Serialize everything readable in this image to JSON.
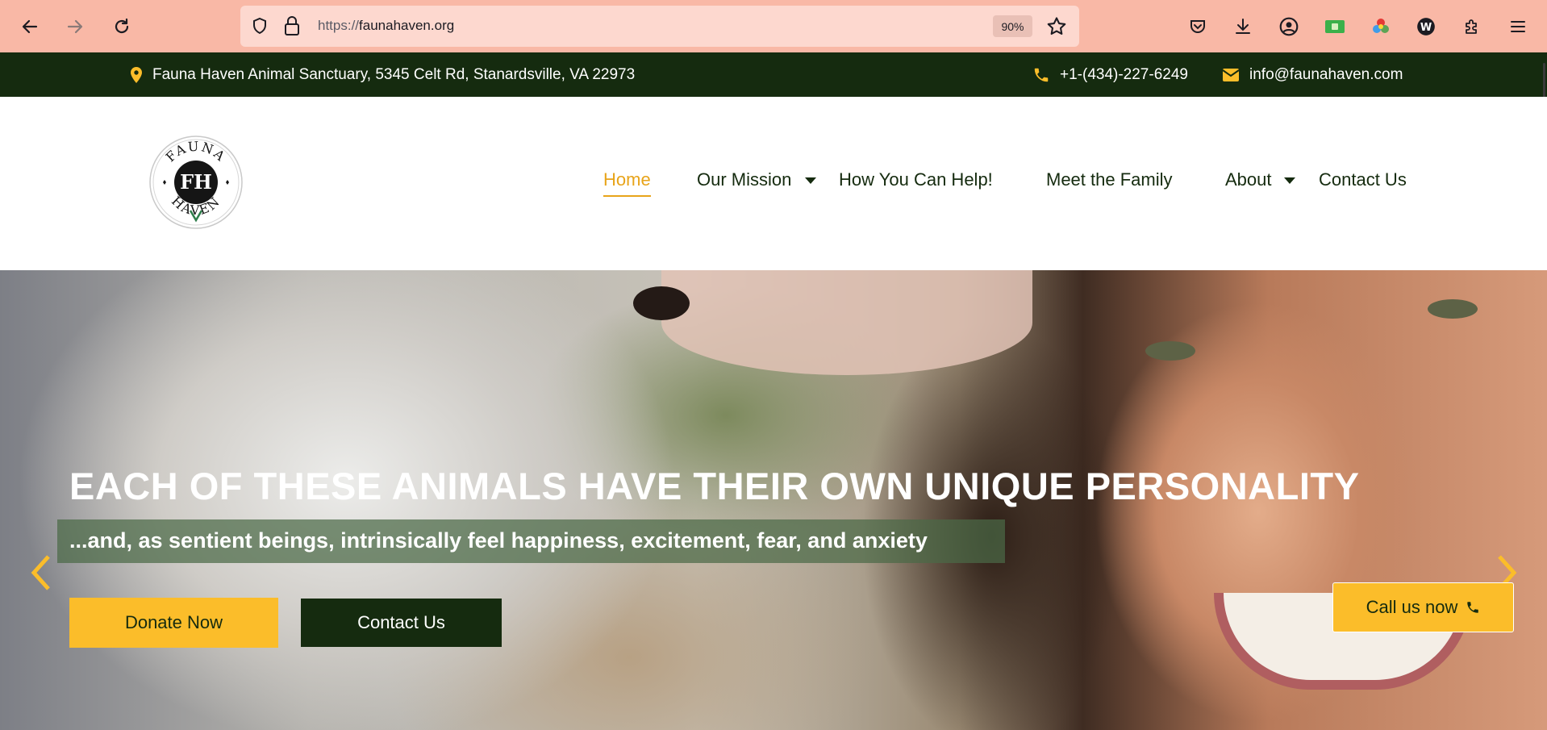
{
  "browser": {
    "url_protocol": "https://",
    "url_domain": "faunahaven.org",
    "zoom": "90%"
  },
  "info_bar": {
    "address": "Fauna Haven Animal Sanctuary, 5345 Celt Rd, Stanardsville, VA 22973",
    "phone": "+1-(434)-227-6249",
    "email": "info@faunahaven.com"
  },
  "logo": {
    "top_text": "FAUNA",
    "monogram": "FH",
    "bottom_text": "HAVEN"
  },
  "nav": {
    "items": [
      {
        "label": "Home",
        "active": true
      },
      {
        "label": "Our Mission",
        "has_dropdown": true
      },
      {
        "label": "How You Can Help!"
      },
      {
        "label": "Meet the Family"
      },
      {
        "label": "About",
        "has_dropdown": true
      },
      {
        "label": "Contact Us"
      }
    ]
  },
  "hero": {
    "title": "EACH OF THESE ANIMALS HAVE THEIR OWN UNIQUE PERSONALITY",
    "subtitle": "...and, as sentient beings, intrinsically feel happiness, excitement, fear, and anxiety",
    "donate_label": "Donate Now",
    "contact_label": "Contact Us",
    "call_label": "Call us now"
  },
  "colors": {
    "brand_dark_green": "#152b0f",
    "accent_yellow": "#fbbd2a",
    "active_nav": "#e8a41a",
    "browser_bar": "#f9b8a6"
  }
}
